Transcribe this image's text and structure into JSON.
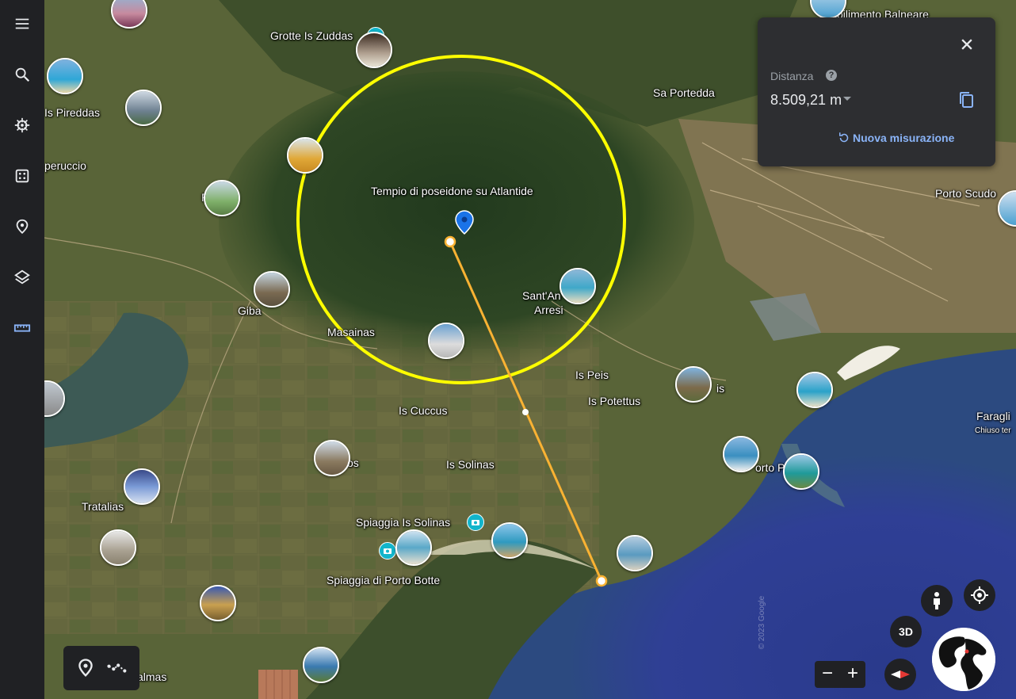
{
  "sidebar": {
    "items": [
      {
        "name": "menu"
      },
      {
        "name": "search"
      },
      {
        "name": "voyager"
      },
      {
        "name": "feeling-lucky"
      },
      {
        "name": "projects"
      },
      {
        "name": "map-style"
      },
      {
        "name": "measure",
        "active": true
      }
    ]
  },
  "map": {
    "labels": {
      "grotte": "Grotte Is Zuddas",
      "stabilimento": "bilimento Balneare",
      "pireddas": "Is Pireddas",
      "peruccio": "peruccio",
      "saportedda": "Sa Portedda",
      "portoscudo": "Porto Scudo",
      "tempio": "Tempio di poseidone su Atlantide",
      "santanna_1": "Sant'An",
      "santanna_2": "Arresi",
      "piscinas": "P      s",
      "giba": "Giba",
      "masainas": "Masainas",
      "ispeis": "Is Peis",
      "ispotettus": "Is Potettus",
      "iscuccus": "Is Cuccus",
      "issolinas": "Is Solinas",
      "tratalias": "Tratalias",
      "spiaggia_solinas": "Spiaggia Is Solinas",
      "spiaggia_portobotte": "Spiaggia di Porto Botte",
      "palmas": "almas",
      "faraglioni": "Faragli",
      "chiuso": "Chiuso ter",
      "portopino": "orto P",
      "is_eis": "is",
      "os_frag": "os",
      "copyright": "© 2023 Google"
    }
  },
  "measure": {
    "title": "Distanza",
    "help_glyph": "?",
    "value": "8.509,21 m",
    "new_label": "Nuova misurazione",
    "line_color": "#f9b233",
    "circle_color": "#ffff00"
  },
  "controls": {
    "three_d": "3D",
    "zoom_out": "−",
    "zoom_in": "+"
  }
}
